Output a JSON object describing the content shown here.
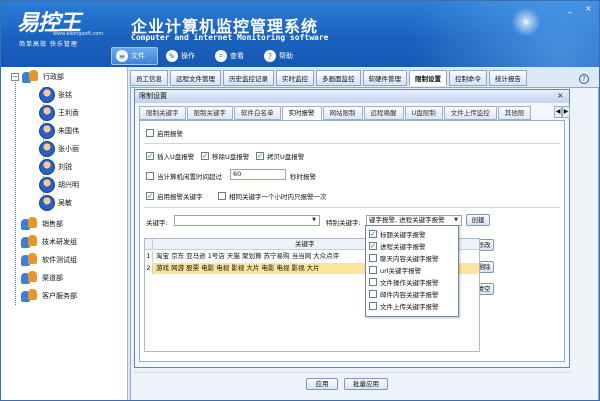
{
  "header": {
    "logo": "易控王",
    "logo_url": "www.ekongsoft.com",
    "slogan": "简单高效 快乐管理",
    "title": "企业计算机监控管理系统",
    "subtitle": "Computer and internet Monitoring software",
    "window_controls": [
      "_",
      "×"
    ],
    "menu": [
      {
        "label": "文件",
        "icon": "file-icon",
        "glyph": "≡"
      },
      {
        "label": "操作",
        "icon": "tools-icon",
        "glyph": "✎"
      },
      {
        "label": "查看",
        "icon": "search-icon",
        "glyph": "⌕"
      },
      {
        "label": "帮助",
        "icon": "help-icon",
        "glyph": "?"
      }
    ]
  },
  "tree": {
    "root": "行政部",
    "users": [
      "张铭",
      "王利香",
      "朱国伟",
      "张小丽",
      "刘锐",
      "胡兴明",
      "吴敏"
    ],
    "groups": [
      "销售部",
      "技术研发组",
      "软件测试组",
      "渠道部",
      "客户服务部"
    ]
  },
  "main_tabs": [
    "员工信息",
    "远程文件管理",
    "历史监控记录",
    "实时监控",
    "多画面监控",
    "软硬件管理",
    "限制设置",
    "控制命令",
    "统计报告"
  ],
  "main_tab_active": 6,
  "dialog": {
    "title": "限制设置",
    "close": "×",
    "subtabs": [
      "限制关键字",
      "限制关键字",
      "软件白名单",
      "实时报警",
      "网站限制",
      "远程唤醒",
      "U盘限制",
      "文件上传监控",
      "其他限"
    ],
    "subtab_active": 3,
    "enable_alarm": "启用报警",
    "usb_alarms": [
      {
        "label": "插入U盘报警",
        "checked": true
      },
      {
        "label": "移除U盘报警",
        "checked": true
      },
      {
        "label": "拷贝U盘报警",
        "checked": true
      }
    ],
    "idle_prefix": "当计算机闲置时间超过",
    "idle_value": "60",
    "idle_suffix": "秒时报警",
    "enable_keyword_alarm": "启用报警关键字",
    "same_keyword_once": "相同关键字一个小时内只报警一次",
    "keyword_label": "关键字:",
    "special_label": "特别关键字:",
    "special_value": "键字报警, 进程关键字报警",
    "grid_header": "关键字",
    "grid_rows": [
      {
        "n": "1",
        "text": "淘宝  京东  亚马逊  1号店  天猫  聚划算  苏宁易购  当当网  大众点评",
        "highlight": false
      },
      {
        "n": "2",
        "text": "游戏  网游  股票  电影  电视  影视  大片  电影  电视  影视  大片",
        "highlight": true
      }
    ],
    "buttons": {
      "create": "创建",
      "modify": "修改",
      "delete": "删除",
      "clear": "清空",
      "apply": "应用",
      "batch_apply": "批量应用"
    },
    "dropdown_options": [
      {
        "label": "标题关键字报警",
        "checked": true
      },
      {
        "label": "进程关键字报警",
        "checked": true
      },
      {
        "label": "聊天内容关键字报警",
        "checked": false
      },
      {
        "label": "url关键字报警",
        "checked": false
      },
      {
        "label": "文件操作关键字报警",
        "checked": false
      },
      {
        "label": "邮件内容关键字报警",
        "checked": false
      },
      {
        "label": "文件上传关键字报警",
        "checked": false
      }
    ]
  },
  "colors": {
    "header": "#1b62bf",
    "highlight_row": "#fbe59a",
    "check": "#1d8a2a"
  }
}
